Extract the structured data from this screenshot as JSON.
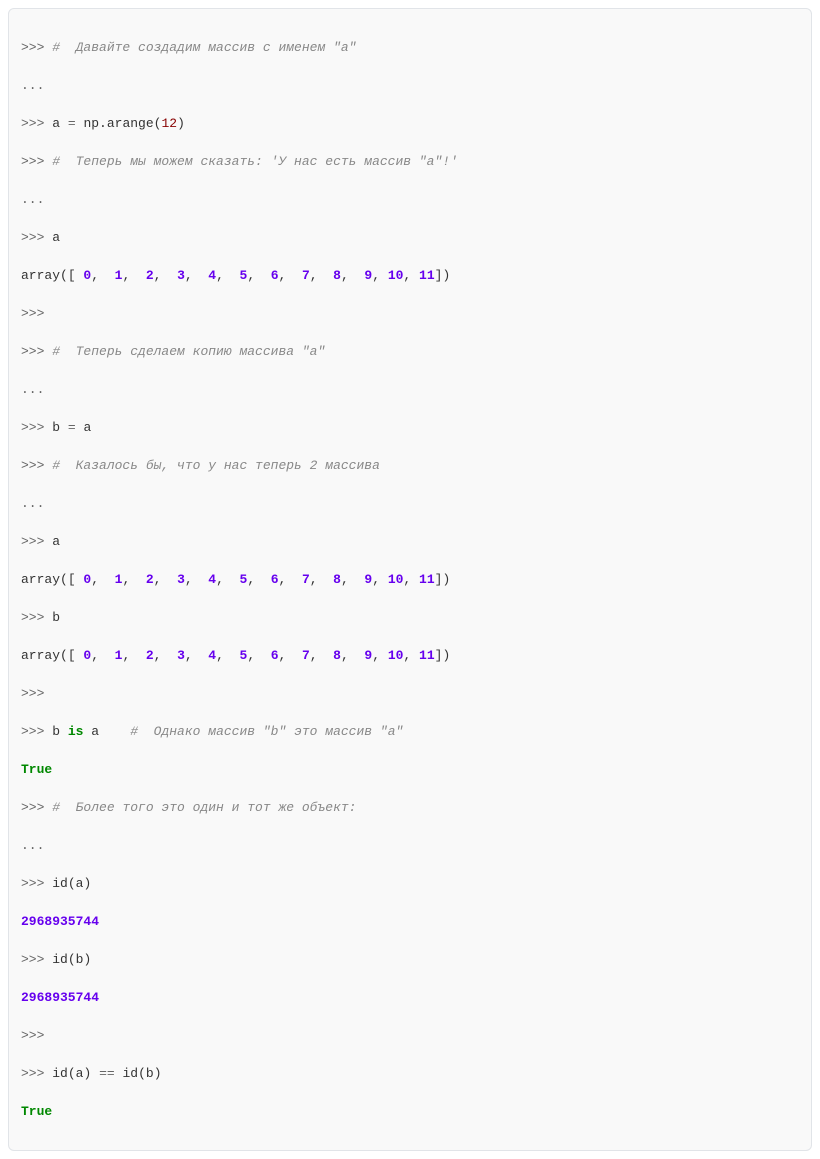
{
  "lines": {
    "p": ">>> ",
    "c": "...",
    "comment1": "#  Давайте создадим массив с именем \"a\"",
    "assign_a_lhs": "a ",
    "eq": "= ",
    "np_arange": "np.arange(",
    "twelve": "12",
    "rparen": ")",
    "comment2": "#  Теперь мы можем сказать: 'У нас есть массив \"a\"!'",
    "show_a": "a",
    "array_word": "array",
    "arr_open": "([ ",
    "arr_nums": [
      "0",
      "1",
      "2",
      "3",
      "4",
      "5",
      "6",
      "7",
      "8",
      "9",
      "10",
      "11"
    ],
    "arr_close": "])",
    "comment3": "#  Теперь сделаем копию массива \"a\"",
    "assign_b_lhs": "b ",
    "a_rhs": "a",
    "comment4": "#  Казалось бы, что у нас теперь 2 массива",
    "show_b": "b",
    "b_is_a": {
      "b": "b ",
      "is": "is",
      "a": " a    ",
      "cmt": "#  Однако массив \"b\" это массив \"a\""
    },
    "true_out": "True",
    "comment5": "#  Более того это один и тот же объект:",
    "id_a": {
      "fn": "id",
      "lp": "(",
      "arg": "a",
      "rp": ")"
    },
    "id_a_out": "2968935744",
    "id_b": {
      "fn": "id",
      "lp": "(",
      "arg": "b",
      "rp": ")"
    },
    "id_b_out": "2968935744",
    "id_cmp": {
      "fn": "id",
      "lp": "(",
      "a": "a",
      "rp": ")",
      "sp": " ",
      "eqeq": "==",
      "sp2": " ",
      "fn2": "id",
      "lp2": "(",
      "b": "b",
      "rp2": ")"
    },
    "true_out2": "True"
  }
}
